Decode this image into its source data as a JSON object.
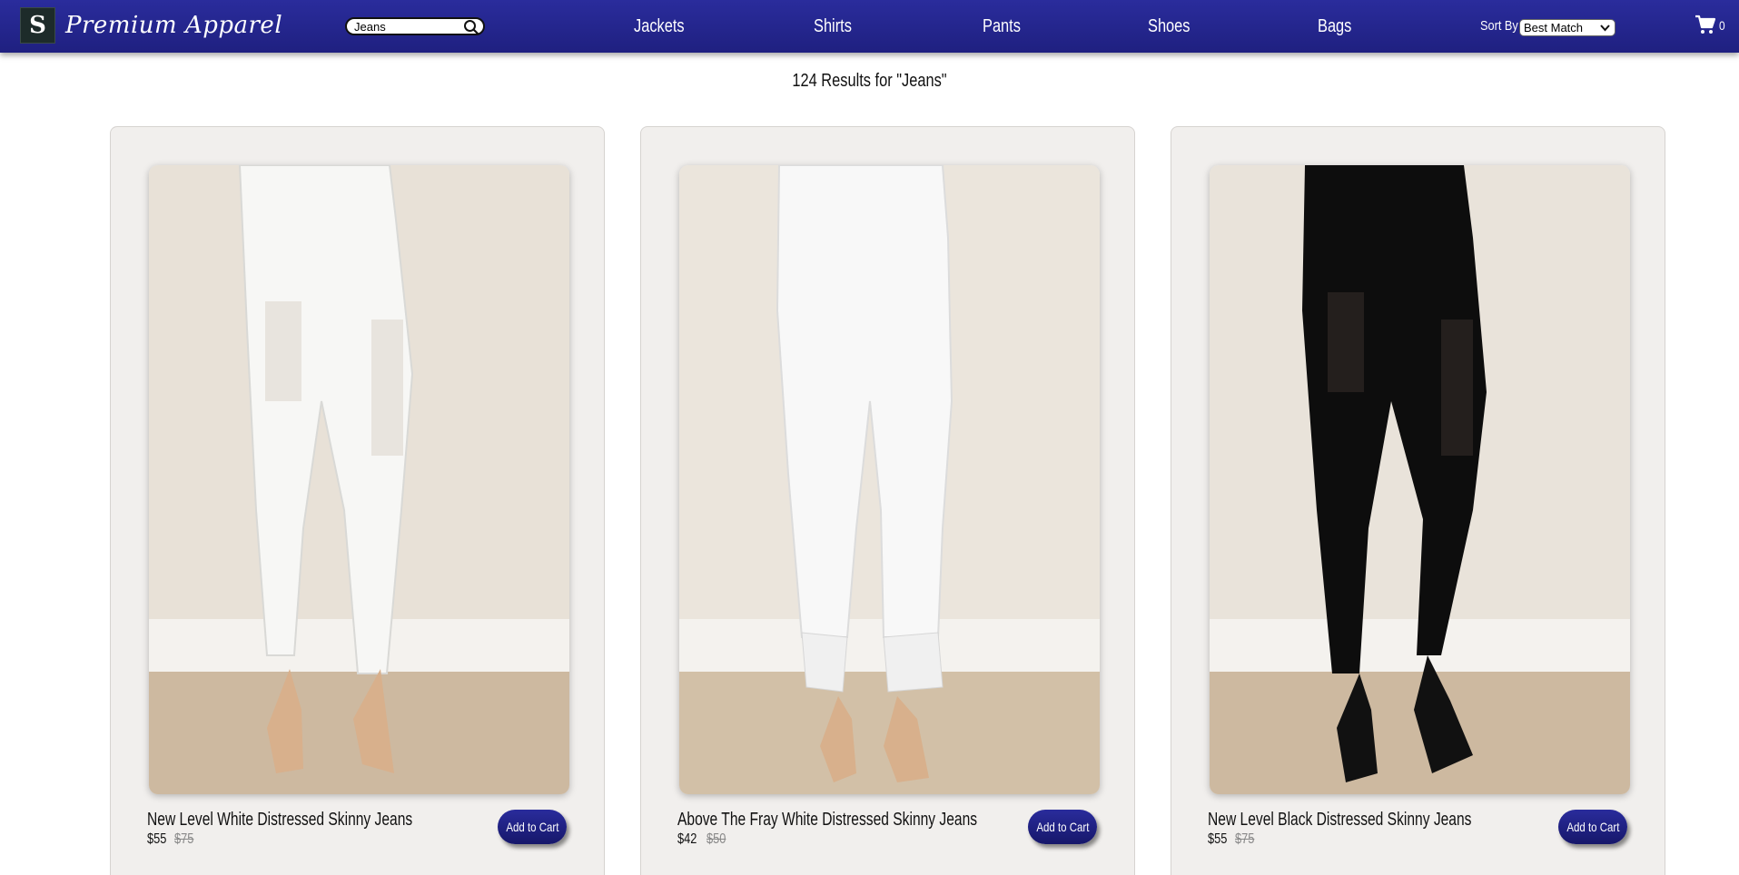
{
  "header": {
    "logo_letter": "S",
    "brand": "Premium Apparel",
    "search": {
      "value": "Jeans",
      "icon": "search-icon"
    },
    "nav": [
      "Jackets",
      "Shirts",
      "Pants",
      "Shoes",
      "Bags"
    ],
    "sort": {
      "label": "Sort By",
      "selected": "Best Match"
    },
    "cart": {
      "icon": "cart-icon",
      "count": "0"
    },
    "colors": {
      "header_bg": "#2326a0"
    }
  },
  "results": {
    "title": "124 Results for \"Jeans\""
  },
  "products": [
    {
      "name": "New Level White Distressed Skinny Jeans",
      "price": "$55",
      "old_price": "$75",
      "button": "Add to Cart",
      "jean_color": "#f7f7f5",
      "shoe": "nude"
    },
    {
      "name": "Above The Fray White Distressed Skinny Jeans",
      "price": "$42",
      "old_price": "$50",
      "button": "Add to Cart",
      "jean_color": "#f8f8f8",
      "shoe": "nude"
    },
    {
      "name": "New Level Black Distressed Skinny Jeans",
      "price": "$55",
      "old_price": "$75",
      "button": "Add to Cart",
      "jean_color": "#0d0d0d",
      "shoe": "black"
    }
  ],
  "accent": "#23248e"
}
